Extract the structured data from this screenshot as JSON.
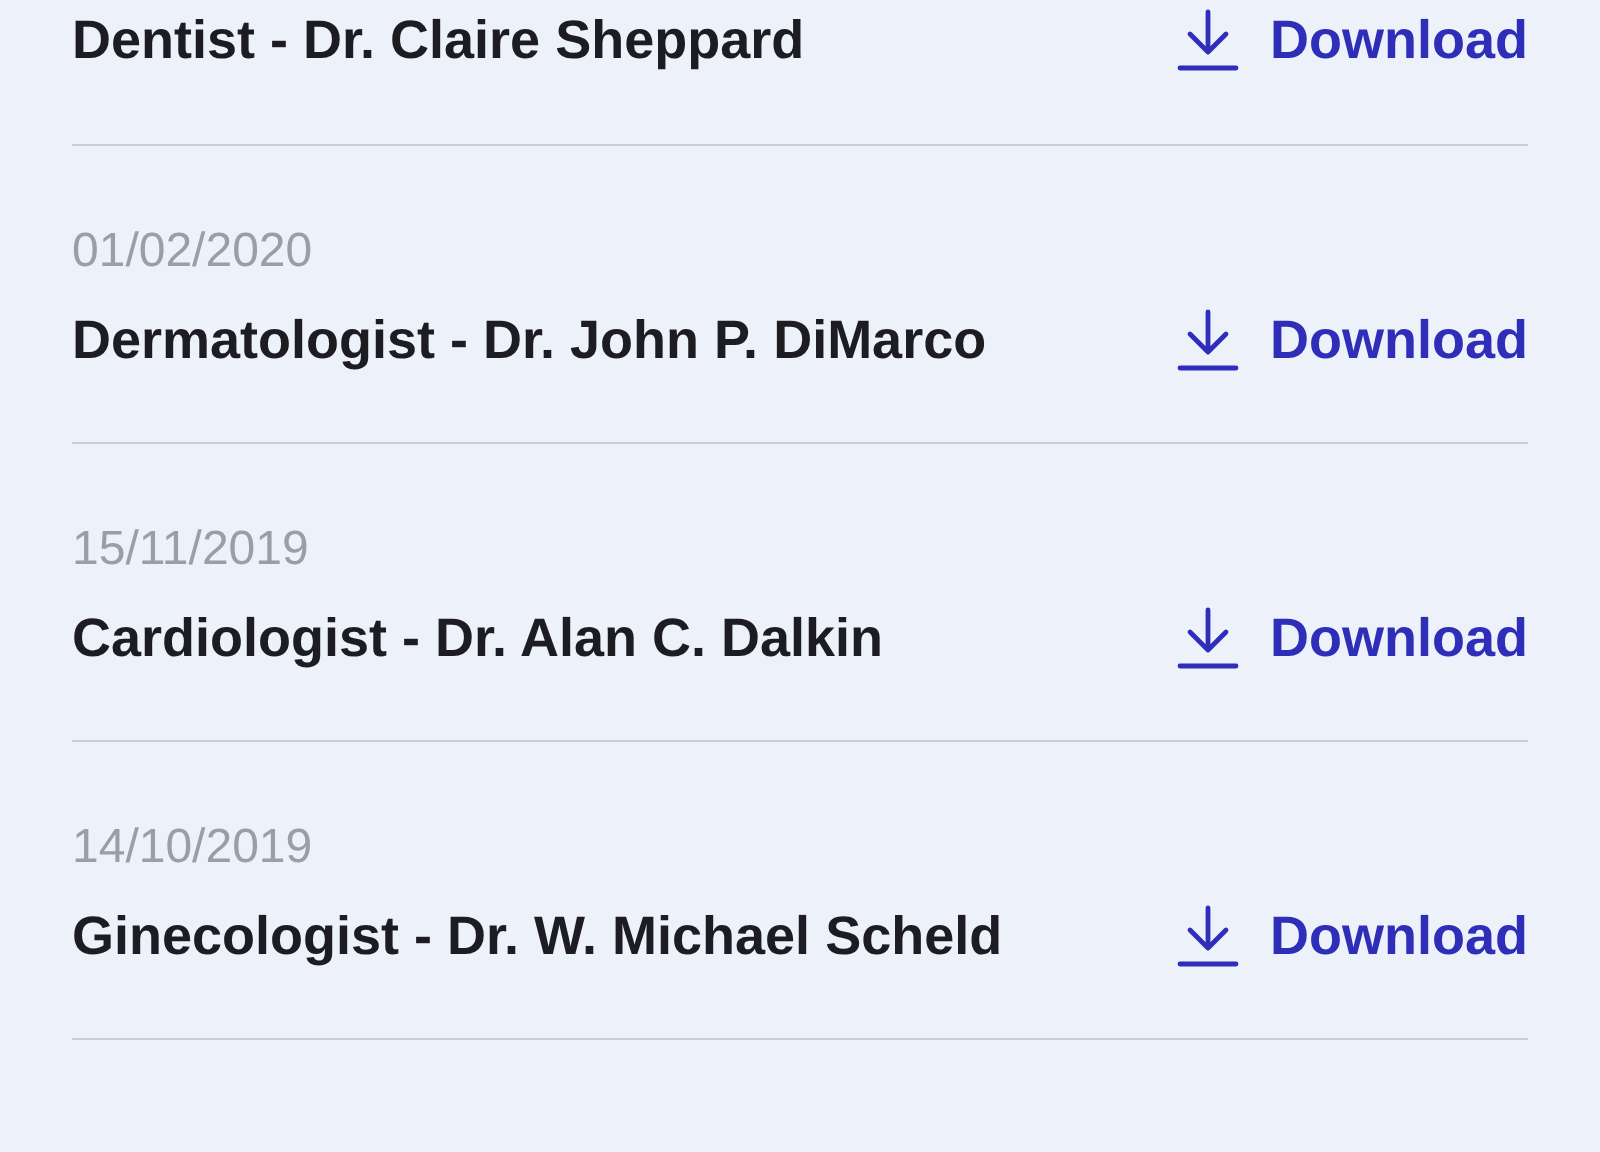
{
  "reports": [
    {
      "title": "Dentist - Dr. Claire Sheppard",
      "action": "Download"
    },
    {
      "date": "01/02/2020",
      "title": "Dermatologist - Dr. John P. DiMarco",
      "action": "Download"
    },
    {
      "date": "15/11/2019",
      "title": "Cardiologist - Dr. Alan C. Dalkin",
      "action": "Download"
    },
    {
      "date": "14/10/2019",
      "title": "Ginecologist - Dr. W. Michael Scheld",
      "action": "Download"
    }
  ]
}
